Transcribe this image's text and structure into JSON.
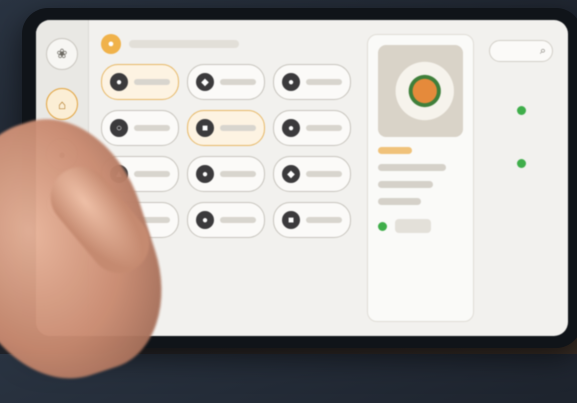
{
  "colors": {
    "accent": "#f0b24a",
    "status_ok": "#3fae4a",
    "screen_bg": "#f2f1ee"
  },
  "categories": [
    {
      "icon": "leaf-icon",
      "glyph": "❀",
      "active": false
    },
    {
      "icon": "chef-hat-icon",
      "glyph": "⌂",
      "active": true
    },
    {
      "icon": "drink-icon",
      "glyph": "●",
      "active": false
    },
    {
      "icon": "dessert-icon",
      "glyph": "▲",
      "active": false
    }
  ],
  "ingredients": [
    {
      "icon": "pepper-icon",
      "glyph": "●",
      "selected": true
    },
    {
      "icon": "fish-icon",
      "glyph": "◆",
      "selected": false
    },
    {
      "icon": "tomato-icon",
      "glyph": "●",
      "selected": false
    },
    {
      "icon": "egg-icon",
      "glyph": "○",
      "selected": false
    },
    {
      "icon": "cheese-icon",
      "glyph": "■",
      "selected": true
    },
    {
      "icon": "onion-icon",
      "glyph": "●",
      "selected": false
    },
    {
      "icon": "mushroom-icon",
      "glyph": "▲",
      "selected": false
    },
    {
      "icon": "eggplant-icon",
      "glyph": "●",
      "selected": false
    },
    {
      "icon": "chili-icon",
      "glyph": "◆",
      "selected": false
    },
    {
      "icon": "garlic-icon",
      "glyph": "○",
      "selected": false
    },
    {
      "icon": "olive-icon",
      "glyph": "●",
      "selected": false
    },
    {
      "icon": "corn-icon",
      "glyph": "■",
      "selected": false
    }
  ],
  "dish": {
    "photo_icon": "dish-photo"
  },
  "status_col": {
    "search_icon": "search-icon",
    "search_glyph": "⌕"
  }
}
